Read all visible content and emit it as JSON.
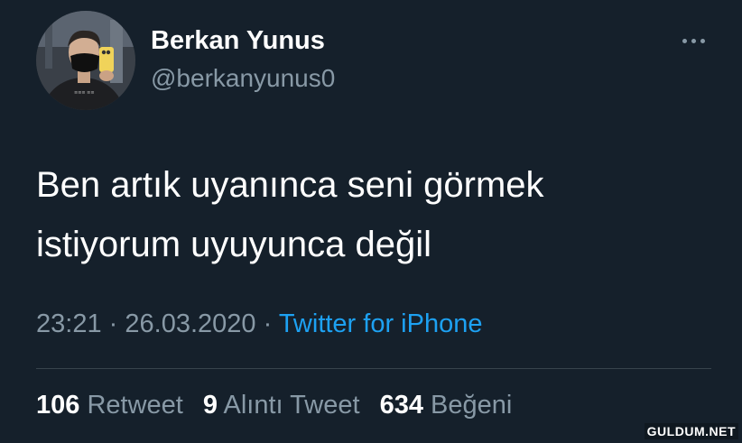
{
  "user": {
    "display_name": "Berkan Yunus",
    "handle": "@berkanyunus0"
  },
  "tweet": {
    "text_line1": "Ben artık uyanınca seni görmek",
    "text_line2": "istiyorum uyuyunca değil",
    "time": "23:21",
    "separator": "·",
    "date": "26.03.2020",
    "source": "Twitter for iPhone"
  },
  "stats": {
    "retweets_count": "106",
    "retweets_label": "Retweet",
    "quotes_count": "9",
    "quotes_label": "Alıntı Tweet",
    "likes_count": "634",
    "likes_label": "Beğeni"
  },
  "icons": {
    "more": "more-options-icon"
  },
  "watermark": "GULDUM.NET",
  "colors": {
    "background": "#15202b",
    "text": "#ffffff",
    "secondary": "#8899a6",
    "link": "#1da1f2",
    "divider": "#38444d"
  }
}
